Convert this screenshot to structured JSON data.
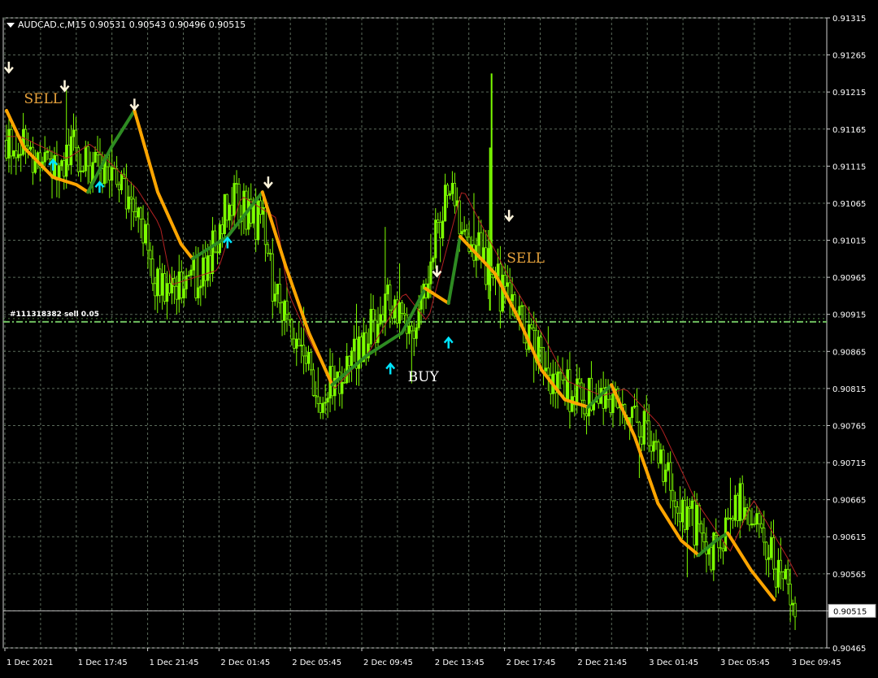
{
  "header": {
    "symbol": "AUDCAD.c",
    "timeframe": "M15",
    "title_text": "AUDCAD.c,M15  0.90531 0.90543 0.90496 0.90515"
  },
  "order_line": {
    "label": "#111318382 sell 0.05",
    "price": 0.90905
  },
  "current_price": {
    "label": "0.90515",
    "price": 0.90515
  },
  "colors": {
    "background": "#000000",
    "grid": "#5a6a5a",
    "candles": "#7CFC00",
    "trend_up": "#2E8B22",
    "trend_down": "#FFA500",
    "ma_thin": "#B22222",
    "arrow_up": "#00E5FF",
    "arrow_down": "#FFF5DC",
    "signal_text_sell": "#E8A33C",
    "signal_text_buy": "#FFFFFF",
    "order_line": "#6fbf5f"
  },
  "chart_data": {
    "type": "candlestick",
    "ylim": [
      0.90465,
      0.91315
    ],
    "y_ticks": [
      "0.91315",
      "0.91265",
      "0.91215",
      "0.91165",
      "0.91115",
      "0.91065",
      "0.91015",
      "0.90965",
      "0.90915",
      "0.90865",
      "0.90815",
      "0.90765",
      "0.90715",
      "0.90665",
      "0.90615",
      "0.90565",
      "0.90515",
      "0.90465"
    ],
    "x_ticks": [
      "1 Dec 2021",
      "1 Dec 17:45",
      "1 Dec 21:45",
      "2 Dec 01:45",
      "2 Dec 05:45",
      "2 Dec 09:45",
      "2 Dec 13:45",
      "2 Dec 17:45",
      "2 Dec 21:45",
      "3 Dec 01:45",
      "3 Dec 05:45",
      "3 Dec 09:45"
    ],
    "price_path": [
      [
        0,
        0.9115
      ],
      [
        4,
        0.9112
      ],
      [
        6,
        0.9114
      ],
      [
        10,
        0.9108
      ],
      [
        12,
        0.9103
      ],
      [
        13,
        0.9095
      ],
      [
        17,
        0.9097
      ],
      [
        19,
        0.9107
      ],
      [
        22,
        0.9104
      ],
      [
        23,
        0.9094
      ],
      [
        25,
        0.9087
      ],
      [
        27,
        0.9081
      ],
      [
        30,
        0.9086
      ],
      [
        33,
        0.9094
      ],
      [
        35,
        0.909
      ],
      [
        38,
        0.9108
      ],
      [
        42,
        0.9096
      ],
      [
        45,
        0.9088
      ],
      [
        47,
        0.9082
      ],
      [
        50,
        0.908
      ],
      [
        52,
        0.9081
      ],
      [
        55,
        0.9076
      ],
      [
        58,
        0.9066
      ],
      [
        61,
        0.9059
      ],
      [
        63,
        0.9066
      ],
      [
        66,
        0.9058
      ],
      [
        68,
        0.9052
      ]
    ],
    "trend_line": [
      {
        "segment": "down",
        "points": [
          [
            0,
            0.9119
          ],
          [
            1.5,
            0.9114
          ],
          [
            4,
            0.911
          ],
          [
            6,
            0.9109
          ],
          [
            7,
            0.9108
          ]
        ]
      },
      {
        "segment": "up",
        "points": [
          [
            7,
            0.9108
          ],
          [
            9,
            0.9114
          ],
          [
            11,
            0.9119
          ]
        ]
      },
      {
        "segment": "down",
        "points": [
          [
            11,
            0.9119
          ],
          [
            13,
            0.9108
          ],
          [
            15,
            0.9101
          ],
          [
            16,
            0.9099
          ]
        ]
      },
      {
        "segment": "up",
        "points": [
          [
            16,
            0.9099
          ],
          [
            19,
            0.9102
          ],
          [
            22,
            0.9108
          ]
        ]
      },
      {
        "segment": "down",
        "points": [
          [
            22,
            0.9108
          ],
          [
            24,
            0.9098
          ],
          [
            26,
            0.9089
          ],
          [
            28,
            0.9082
          ]
        ]
      },
      {
        "segment": "up",
        "points": [
          [
            28,
            0.9082
          ],
          [
            31,
            0.9086
          ],
          [
            34,
            0.9089
          ],
          [
            36,
            0.9095
          ]
        ]
      },
      {
        "segment": "down",
        "points": [
          [
            36,
            0.9095
          ],
          [
            38,
            0.9093
          ]
        ]
      },
      {
        "segment": "up",
        "points": [
          [
            38,
            0.9093
          ],
          [
            39,
            0.9102
          ]
        ]
      },
      {
        "segment": "down",
        "points": [
          [
            39,
            0.9102
          ],
          [
            42,
            0.9097
          ],
          [
            44,
            0.9091
          ],
          [
            46,
            0.9084
          ],
          [
            48,
            0.908
          ],
          [
            50,
            0.9079
          ]
        ]
      },
      {
        "segment": "up",
        "points": [
          [
            50,
            0.9079
          ],
          [
            52,
            0.9082
          ]
        ]
      },
      {
        "segment": "down",
        "points": [
          [
            52,
            0.9082
          ],
          [
            54,
            0.9075
          ],
          [
            56,
            0.9066
          ],
          [
            58,
            0.9061
          ],
          [
            59.5,
            0.9059
          ]
        ]
      },
      {
        "segment": "up",
        "points": [
          [
            59.5,
            0.9059
          ],
          [
            61,
            0.9061
          ],
          [
            62,
            0.9062
          ]
        ]
      },
      {
        "segment": "down",
        "points": [
          [
            62,
            0.9062
          ],
          [
            64,
            0.9057
          ],
          [
            66,
            0.9053
          ]
        ]
      }
    ],
    "signals": [
      {
        "type": "sell",
        "arrow": "down",
        "x": 0.2,
        "price": 0.91245
      },
      {
        "type": "sell",
        "arrow": "down",
        "x": 5,
        "price": 0.9122
      },
      {
        "type": "sell",
        "arrow": "down",
        "x": 11,
        "price": 0.91195
      },
      {
        "type": "sell",
        "arrow": "down",
        "x": 22.5,
        "price": 0.9109
      },
      {
        "type": "sell",
        "arrow": "down",
        "x": 37,
        "price": 0.9097
      },
      {
        "type": "sell",
        "arrow": "down",
        "x": 43.2,
        "price": 0.91045
      },
      {
        "type": "buy",
        "arrow": "up",
        "x": 4,
        "price": 0.9112
      },
      {
        "type": "buy",
        "arrow": "up",
        "x": 8,
        "price": 0.9109
      },
      {
        "type": "buy",
        "arrow": "up",
        "x": 19,
        "price": 0.91015
      },
      {
        "type": "buy",
        "arrow": "up",
        "x": 33,
        "price": 0.90845
      },
      {
        "type": "buy",
        "arrow": "up",
        "x": 38,
        "price": 0.9088
      }
    ],
    "labels": [
      {
        "text": "SELL",
        "x": 1.5,
        "price": 0.912
      },
      {
        "text": "SELL",
        "x": 43,
        "price": 0.90985
      },
      {
        "text": "BUY",
        "x": 34.5,
        "price": 0.90825
      }
    ]
  }
}
